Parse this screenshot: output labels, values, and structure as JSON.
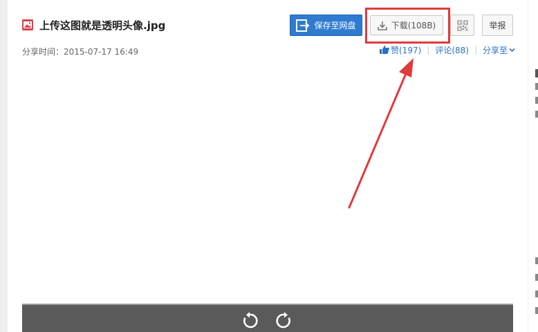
{
  "file": {
    "name": "上传这图就是透明头像.jpg",
    "icon": "image-file-icon",
    "share_time": "分享时间：2015-07-17 16:49"
  },
  "toolbar": {
    "save_label": "保存至网盘",
    "download_label": "下载(108B)",
    "report_label": "举报",
    "qr_icon": "qr-code-icon"
  },
  "actions": {
    "like_label": "赞(197)",
    "comment_label": "评论(88)",
    "share_label": "分享至"
  },
  "viewer": {
    "rotate_left_icon": "rotate-left-icon",
    "rotate_right_icon": "rotate-right-icon"
  },
  "colors": {
    "primary_button": "#2f7bd1",
    "link": "#2b6fc6",
    "annotation": "#e03a3a",
    "toolbar_bg": "#5a5a5a"
  }
}
